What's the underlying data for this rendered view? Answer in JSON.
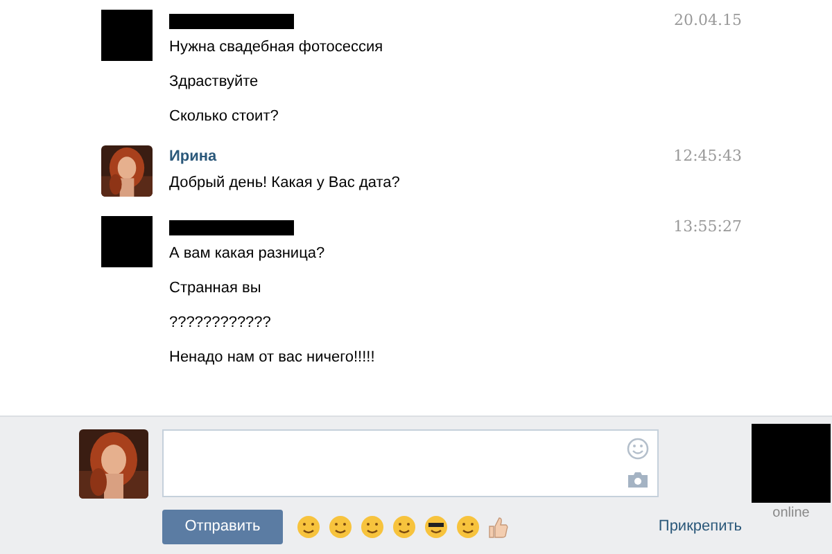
{
  "messages": [
    {
      "avatar_redacted": true,
      "name_redacted": true,
      "time": "20.04.15",
      "texts": [
        "Нужна свадебная фотосессия",
        "Здраствуйте",
        "Сколько стоит?"
      ]
    },
    {
      "avatar_redacted": false,
      "name": "Ирина",
      "time": "12:45:43",
      "texts": [
        "Добрый день! Какая у Вас дата?"
      ]
    },
    {
      "avatar_redacted": true,
      "name_redacted": true,
      "time": "13:55:27",
      "texts": [
        "А вам какая разница?",
        "Странная вы",
        "????????????",
        "Ненадо нам от вас ничего!!!!!"
      ]
    }
  ],
  "composer": {
    "avatar_redacted": false,
    "send_button": "Отправить",
    "attach_link": "Прикрепить",
    "peer_avatar_redacted": true,
    "peer_status": "online"
  }
}
